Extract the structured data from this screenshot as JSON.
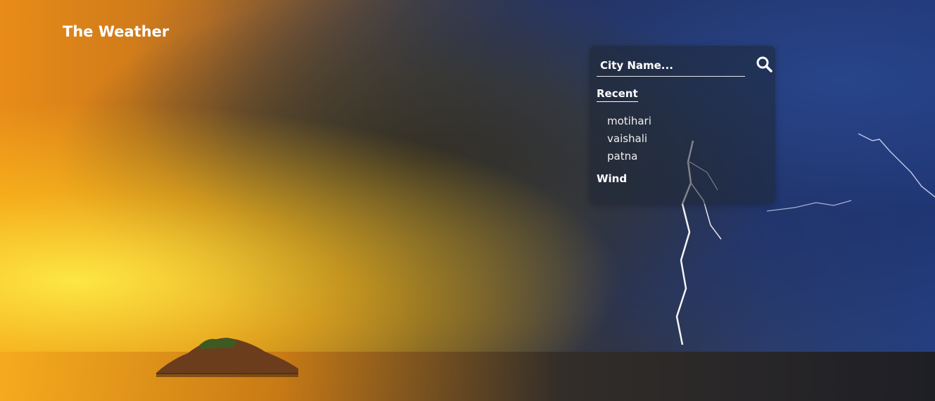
{
  "header": {
    "title": "The Weather"
  },
  "search": {
    "placeholder": "City Name..."
  },
  "recent": {
    "title": "Recent",
    "items": [
      "motihari",
      "vaishali",
      "patna"
    ]
  },
  "wind": {
    "title": "Wind"
  },
  "icons": {
    "search": "search-icon"
  },
  "colors": {
    "text": "#ffffff",
    "panel": "#1e2634"
  }
}
